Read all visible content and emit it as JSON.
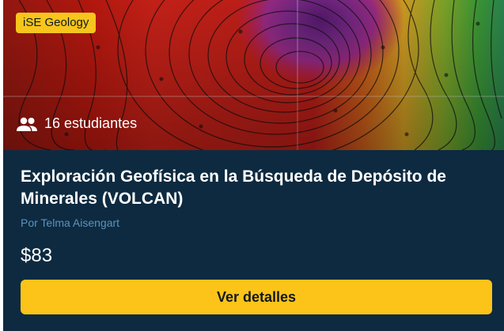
{
  "course": {
    "category_badge": "iSE Geology",
    "students_label": "16 estudiantes",
    "title": "Exploración Geofísica en la Búsqueda de Depósito de Minerales (VOLCAN)",
    "author": "Por Telma Aisengart",
    "price": "$83",
    "cta_label": "Ver detalles",
    "students_icon": "people-icon",
    "hero_image": "geophysical-contour-map"
  },
  "colors": {
    "card_bg": "#0d2a40",
    "badge_bg": "#f7c51c",
    "cta_bg": "#fcc419",
    "author_text": "#5b93bd"
  }
}
